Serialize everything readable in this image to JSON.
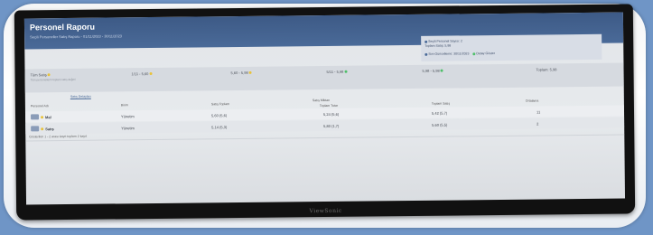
{
  "header": {
    "title": "Personel Raporu",
    "subtitle": "Seçili Personeller Satış Raporu - 01/11/2023 - 30/11/2023"
  },
  "info_panel": {
    "line1": "Seçili Personel Sayısı: 2",
    "line2": "Toplam Satış: 5,98",
    "line3": "Son Güncelleme: 30/11/2023",
    "line3_extra": "Detay Göster"
  },
  "summary": {
    "label": "Tüm Satış",
    "sublabel": "Tüm personellerin toplam satış değeri",
    "cells": [
      "1/11 - 5,60",
      "5,60 - 5,98",
      "5/11 - 5,98",
      "5,98 - 5,98",
      "Toplam: 5,98"
    ]
  },
  "tabs": {
    "active": "Satış Detayları"
  },
  "table": {
    "columns": [
      "Personel Adı",
      "Birim",
      "Satış Toplam",
      "Satış Miktarı",
      "Toplam Tutar",
      "Toplam Satış",
      "Ortalama"
    ],
    "rows": [
      {
        "name": "Mal",
        "dept": "Yönetim",
        "v1": "5,60 (5,6)",
        "v2": "5,24 (5,6)",
        "v3": "5,42 (5,7)",
        "count": "11"
      },
      {
        "name": "Satış",
        "dept": "Yönetim",
        "v1": "5,14 (5,3)",
        "v2": "5,80 (1,7)",
        "v3": "5,60 (5,5)",
        "count": "2"
      }
    ],
    "note": "Gösterilen 1 - 2 arası kayıt toplam 2 kayıt"
  },
  "monitor": {
    "brand": "ViewSonic"
  },
  "colors": {
    "accent": "#4a6a98",
    "yellow": "#e8c23a",
    "green": "#4fbf6a"
  }
}
